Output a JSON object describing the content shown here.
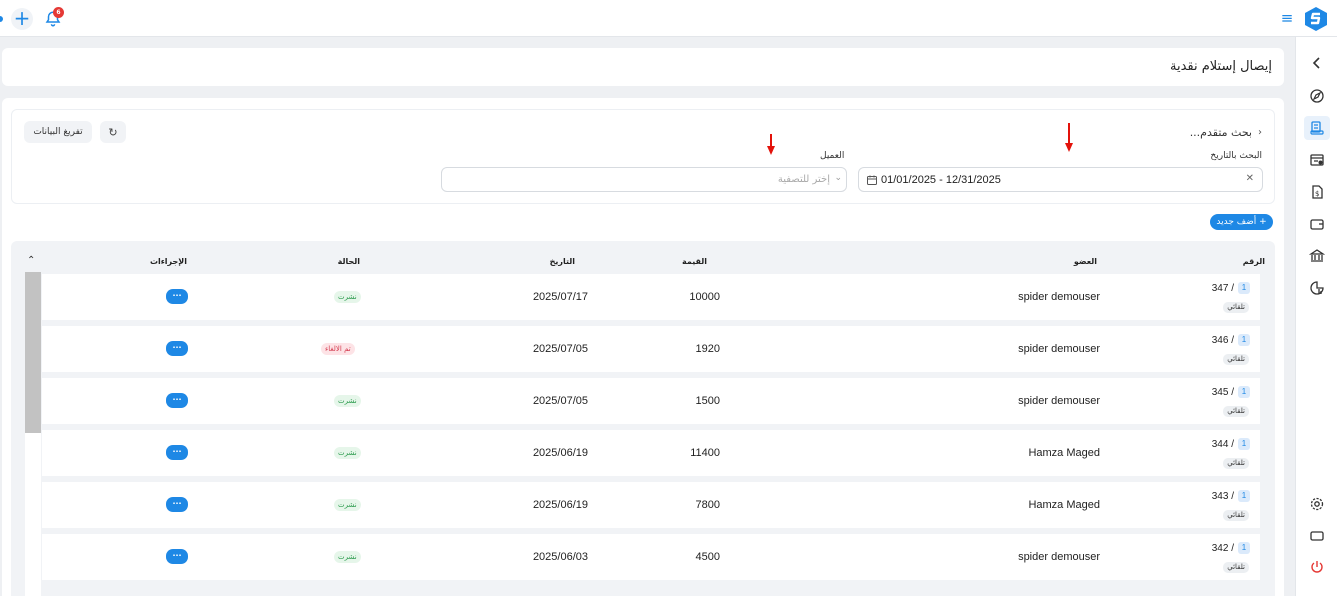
{
  "topbar": {
    "notifications_count": "6",
    "add_icon": "plus-icon",
    "bell_icon": "bell-icon",
    "menu_icon": "hamburger-icon"
  },
  "sidebar": {
    "items": [
      "chevron-left-icon",
      "compass-icon",
      "receipt-icon",
      "invoice-list-icon",
      "money-file-icon",
      "wallet-icon",
      "bank-icon",
      "report-chart-icon",
      "gear-icon",
      "screen-icon",
      "power-icon"
    ]
  },
  "page": {
    "title": "إيصال إستلام نقدية"
  },
  "filters": {
    "advanced_search": "بحث متقدم...",
    "date_label": "البحث بالتاريخ",
    "date_value": "01/01/2025 - 12/31/2025",
    "client_label": "العميل",
    "client_placeholder": "إختر للتصفية",
    "clear_button": "تفريغ البيانات"
  },
  "add_button": "+ أضف جديد",
  "table": {
    "headers": {
      "number": "الرقم",
      "member": "العضو",
      "value": "القيمة",
      "date": "التاريخ",
      "status": "الحالة",
      "actions": "الإجراءات"
    },
    "rows": [
      {
        "prefix": "1",
        "number": "347 /",
        "type": "تلقائي",
        "member": "spider demouser",
        "value": "10000",
        "date": "2025/07/17",
        "status": "نشرت",
        "status_kind": "published",
        "action": "···"
      },
      {
        "prefix": "1",
        "number": "346 /",
        "type": "تلقائي",
        "member": "spider demouser",
        "value": "1920",
        "date": "2025/07/05",
        "status": "تم الالغاء",
        "status_kind": "cancelled",
        "action": "···"
      },
      {
        "prefix": "1",
        "number": "345 /",
        "type": "تلقائي",
        "member": "spider demouser",
        "value": "1500",
        "date": "2025/07/05",
        "status": "نشرت",
        "status_kind": "published",
        "action": "···"
      },
      {
        "prefix": "1",
        "number": "344 /",
        "type": "تلقائي",
        "member": "Hamza Maged",
        "value": "11400",
        "date": "2025/06/19",
        "status": "نشرت",
        "status_kind": "published",
        "action": "···"
      },
      {
        "prefix": "1",
        "number": "343 /",
        "type": "تلقائي",
        "member": "Hamza Maged",
        "value": "7800",
        "date": "2025/06/19",
        "status": "نشرت",
        "status_kind": "published",
        "action": "···"
      },
      {
        "prefix": "1",
        "number": "342 /",
        "type": "تلقائي",
        "member": "spider demouser",
        "value": "4500",
        "date": "2025/06/03",
        "status": "نشرت",
        "status_kind": "published",
        "action": "···"
      }
    ]
  },
  "colors": {
    "accent": "#1e88e5",
    "published": "#2e9c4f",
    "cancelled": "#d3394d",
    "annotation_arrow": "#e3120b"
  }
}
